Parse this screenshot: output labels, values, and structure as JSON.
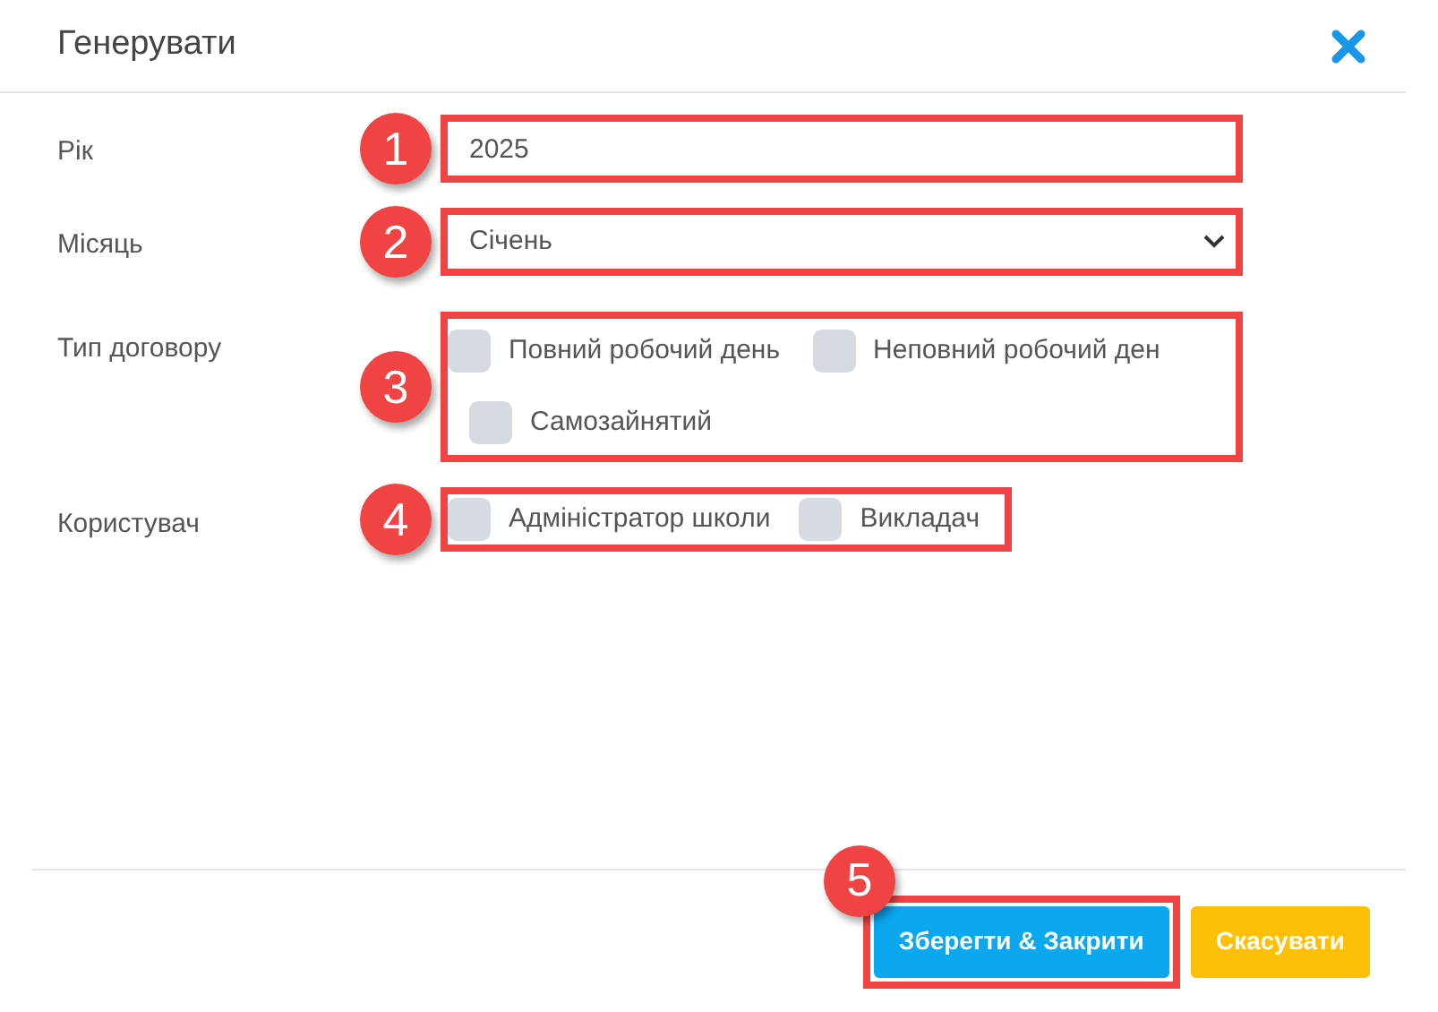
{
  "dialog": {
    "title": "Генерувати"
  },
  "fields": [
    {
      "kind": "text",
      "label": "Рік",
      "value": "2025",
      "callout": "1"
    },
    {
      "kind": "select",
      "label": "Місяць",
      "value": "Січень",
      "callout": "2"
    },
    {
      "kind": "checkboxes",
      "label": "Тип договору",
      "callout": "3",
      "options": [
        {
          "label": "Повний робочий день",
          "checked": false
        },
        {
          "label": "Неповний робочий ден",
          "checked": false
        },
        {
          "label": "Самозайнятий",
          "checked": false
        }
      ]
    },
    {
      "kind": "checkboxes",
      "label": "Користувач",
      "callout": "4",
      "options": [
        {
          "label": "Адміністратор школи",
          "checked": false
        },
        {
          "label": "Викладач",
          "checked": false
        }
      ]
    }
  ],
  "buttons": [
    {
      "kind": "primary",
      "label": "Зберегти & Закрити",
      "callout": "5"
    },
    {
      "kind": "warning",
      "label": "Скасувати"
    }
  ]
}
